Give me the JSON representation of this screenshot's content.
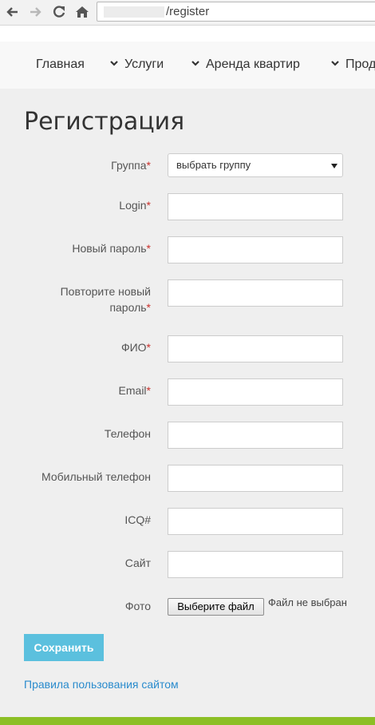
{
  "browser": {
    "url_visible": "/register",
    "icons": [
      "back-arrow-icon",
      "forward-arrow-icon",
      "reload-icon",
      "home-icon"
    ]
  },
  "nav": {
    "items": [
      {
        "label": "Главная",
        "has_chevron": false
      },
      {
        "label": "Услуги",
        "has_chevron": true
      },
      {
        "label": "Аренда квартир",
        "has_chevron": true
      },
      {
        "label": "Прод",
        "has_chevron": true
      }
    ]
  },
  "page": {
    "title": "Регистрация"
  },
  "form": {
    "required_mark": "*",
    "group": {
      "label": "Группа",
      "selected": "выбрать группу"
    },
    "login": {
      "label": "Login",
      "value": ""
    },
    "new_password": {
      "label": "Новый пароль",
      "value": ""
    },
    "repeat_password": {
      "label_line1": "Повторите новый",
      "label_line2": "пароль",
      "value": ""
    },
    "fio": {
      "label": "ФИО",
      "value": ""
    },
    "email": {
      "label": "Email",
      "value": ""
    },
    "phone": {
      "label": "Телефон",
      "value": ""
    },
    "mobile": {
      "label": "Мобильный телефон",
      "value": ""
    },
    "icq": {
      "label": "ICQ#",
      "value": ""
    },
    "site": {
      "label": "Сайт",
      "value": ""
    },
    "photo": {
      "label": "Фото",
      "button": "Выберите файл",
      "status": "Файл не выбран"
    },
    "save_label": "Сохранить",
    "rules_link": "Правила пользования сайтом"
  },
  "colors": {
    "accent_button": "#5bc0de",
    "link": "#2a8bcd",
    "required": "#c9302c",
    "footer": "#8cbf26"
  }
}
